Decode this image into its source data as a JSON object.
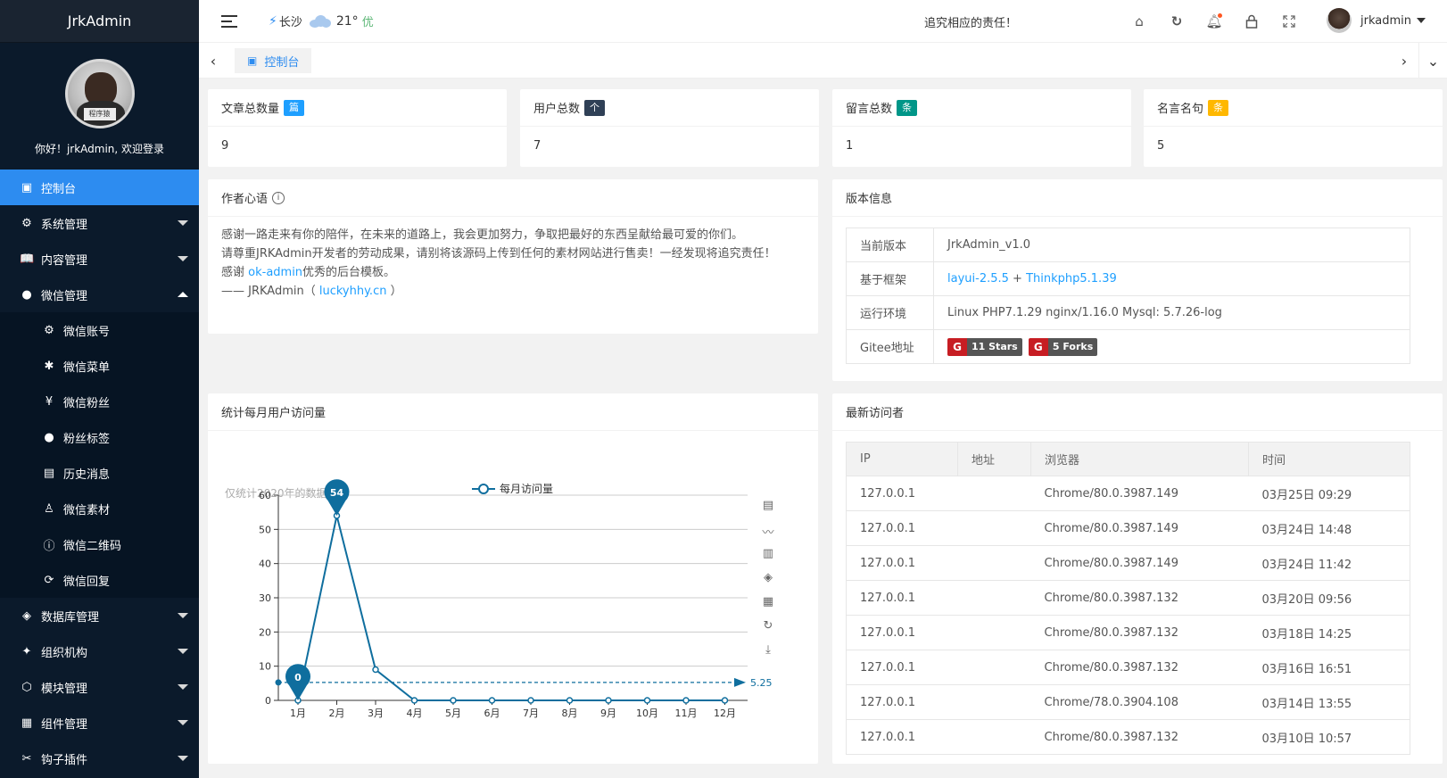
{
  "app": {
    "brand": "JrkAdmin",
    "welcome": "你好！jrkAdmin, 欢迎登录",
    "avatar_tag": "程序猿"
  },
  "sidebar": {
    "items": [
      {
        "label": "控制台",
        "icon": "dashboard-icon",
        "glyph": "▣",
        "active": true
      },
      {
        "label": "系统管理",
        "icon": "gear-icon",
        "glyph": "⚙",
        "caret": "down"
      },
      {
        "label": "内容管理",
        "icon": "book-icon",
        "glyph": "📖",
        "caret": "down"
      },
      {
        "label": "微信管理",
        "icon": "wechat-icon",
        "glyph": "●",
        "caret": "up"
      },
      {
        "label": "微信账号",
        "icon": "settings-icon",
        "glyph": "⚙",
        "sub": true
      },
      {
        "label": "微信菜单",
        "icon": "snowflake-icon",
        "glyph": "✱",
        "sub": true
      },
      {
        "label": "微信粉丝",
        "icon": "yen-icon",
        "glyph": "¥",
        "sub": true
      },
      {
        "label": "粉丝标签",
        "icon": "wechat-icon",
        "glyph": "●",
        "sub": true
      },
      {
        "label": "历史消息",
        "icon": "message-history-icon",
        "glyph": "▤",
        "sub": true
      },
      {
        "label": "微信素材",
        "icon": "user-icon",
        "glyph": "♙",
        "sub": true
      },
      {
        "label": "微信二维码",
        "icon": "info-icon",
        "glyph": "ⓘ",
        "sub": true
      },
      {
        "label": "微信回复",
        "icon": "reply-icon",
        "glyph": "⟳",
        "sub": true
      },
      {
        "label": "数据库管理",
        "icon": "database-icon",
        "glyph": "◈",
        "caret": "down"
      },
      {
        "label": "组织机构",
        "icon": "organization-icon",
        "glyph": "✦",
        "caret": "down"
      },
      {
        "label": "模块管理",
        "icon": "cube-icon",
        "glyph": "⬡",
        "caret": "down"
      },
      {
        "label": "组件管理",
        "icon": "grid-icon",
        "glyph": "▦",
        "caret": "down"
      },
      {
        "label": "钩子插件",
        "icon": "tools-icon",
        "glyph": "✂",
        "caret": "down"
      }
    ]
  },
  "header": {
    "city": "长沙",
    "temperature": "21°",
    "air_quality": "优",
    "notice": "追究相应的责任！",
    "username": "jrkadmin",
    "icons": [
      "home-icon",
      "refresh-icon",
      "bell-icon",
      "lock-icon",
      "fullscreen-icon"
    ]
  },
  "tabs": {
    "active_label": "控制台"
  },
  "stats": [
    {
      "label": "文章总数量",
      "badge": "篇",
      "badge_color": "#1e9fff",
      "value": "9"
    },
    {
      "label": "用户总数",
      "badge": "个",
      "badge_color": "#2f4056",
      "value": "7"
    },
    {
      "label": "留言总数",
      "badge": "条",
      "badge_color": "#009688",
      "value": "1"
    },
    {
      "label": "名言名句",
      "badge": "条",
      "badge_color": "#ffb800",
      "value": "5"
    }
  ],
  "author": {
    "title": "作者心语",
    "line1": "感谢一路走来有你的陪伴，在未来的道路上，我会更加努力，争取把最好的东西呈献给最可爱的你们。",
    "line2": "请尊重JRKAdmin开发者的劳动成果，请别将该源码上传到任何的素材网站进行售卖！一经发现将追究责任！",
    "line3_prefix": "感谢 ",
    "line3_link": "ok-admin",
    "line3_suffix": "优秀的后台模板。",
    "line4_prefix": "—— JRKAdmin（ ",
    "line4_link": "luckyhhy.cn",
    "line4_suffix": " ）"
  },
  "version": {
    "title": "版本信息",
    "rows": [
      {
        "key": "当前版本",
        "value": "JrkAdmin_v1.0"
      },
      {
        "key": "基于框架",
        "link1": "layui-2.5.5",
        "plus": " + ",
        "link2": "Thinkphp5.1.39"
      },
      {
        "key": "运行环境",
        "value": "Linux PHP7.1.29 nginx/1.16.0 Mysql: 5.7.26-log"
      },
      {
        "key": "Gitee地址",
        "stars": "11 Stars",
        "forks": "5 Forks"
      }
    ]
  },
  "chart_card": {
    "title": "统计每月用户访问量",
    "note": "仅统计2020年的数据！"
  },
  "chart_data": {
    "type": "line",
    "title": "",
    "subtitle": "仅统计2020年的数据！",
    "categories": [
      "1月",
      "2月",
      "3月",
      "4月",
      "5月",
      "6月",
      "7月",
      "8月",
      "9月",
      "10月",
      "11月",
      "12月"
    ],
    "series": [
      {
        "name": "每月访问量",
        "values": [
          0,
          54,
          9,
          0,
          0,
          0,
          0,
          0,
          0,
          0,
          0,
          0
        ],
        "color": "#0f6e9e"
      }
    ],
    "max_label": "54",
    "min_label": "0",
    "average": 5.25,
    "average_label": "5.25",
    "ylim": [
      0,
      60
    ],
    "yticks": [
      0,
      10,
      20,
      30,
      40,
      50,
      60
    ],
    "grid": true,
    "legend": "top-center",
    "toolbox": [
      "data-view-icon",
      "line-chart-icon",
      "bar-chart-icon",
      "stack-icon",
      "tiled-icon",
      "restore-icon",
      "download-icon"
    ]
  },
  "visitors": {
    "title": "最新访问者",
    "columns": [
      "IP",
      "地址",
      "浏览器",
      "时间"
    ],
    "rows": [
      [
        "127.0.0.1",
        "",
        "Chrome/80.0.3987.149",
        "03月25日 09:29"
      ],
      [
        "127.0.0.1",
        "",
        "Chrome/80.0.3987.149",
        "03月24日 14:48"
      ],
      [
        "127.0.0.1",
        "",
        "Chrome/80.0.3987.149",
        "03月24日 11:42"
      ],
      [
        "127.0.0.1",
        "",
        "Chrome/80.0.3987.132",
        "03月20日 09:56"
      ],
      [
        "127.0.0.1",
        "",
        "Chrome/80.0.3987.132",
        "03月18日 14:25"
      ],
      [
        "127.0.0.1",
        "",
        "Chrome/80.0.3987.132",
        "03月16日 16:51"
      ],
      [
        "127.0.0.1",
        "",
        "Chrome/78.0.3904.108",
        "03月14日 13:55"
      ],
      [
        "127.0.0.1",
        "",
        "Chrome/80.0.3987.132",
        "03月10日 10:57"
      ]
    ]
  }
}
